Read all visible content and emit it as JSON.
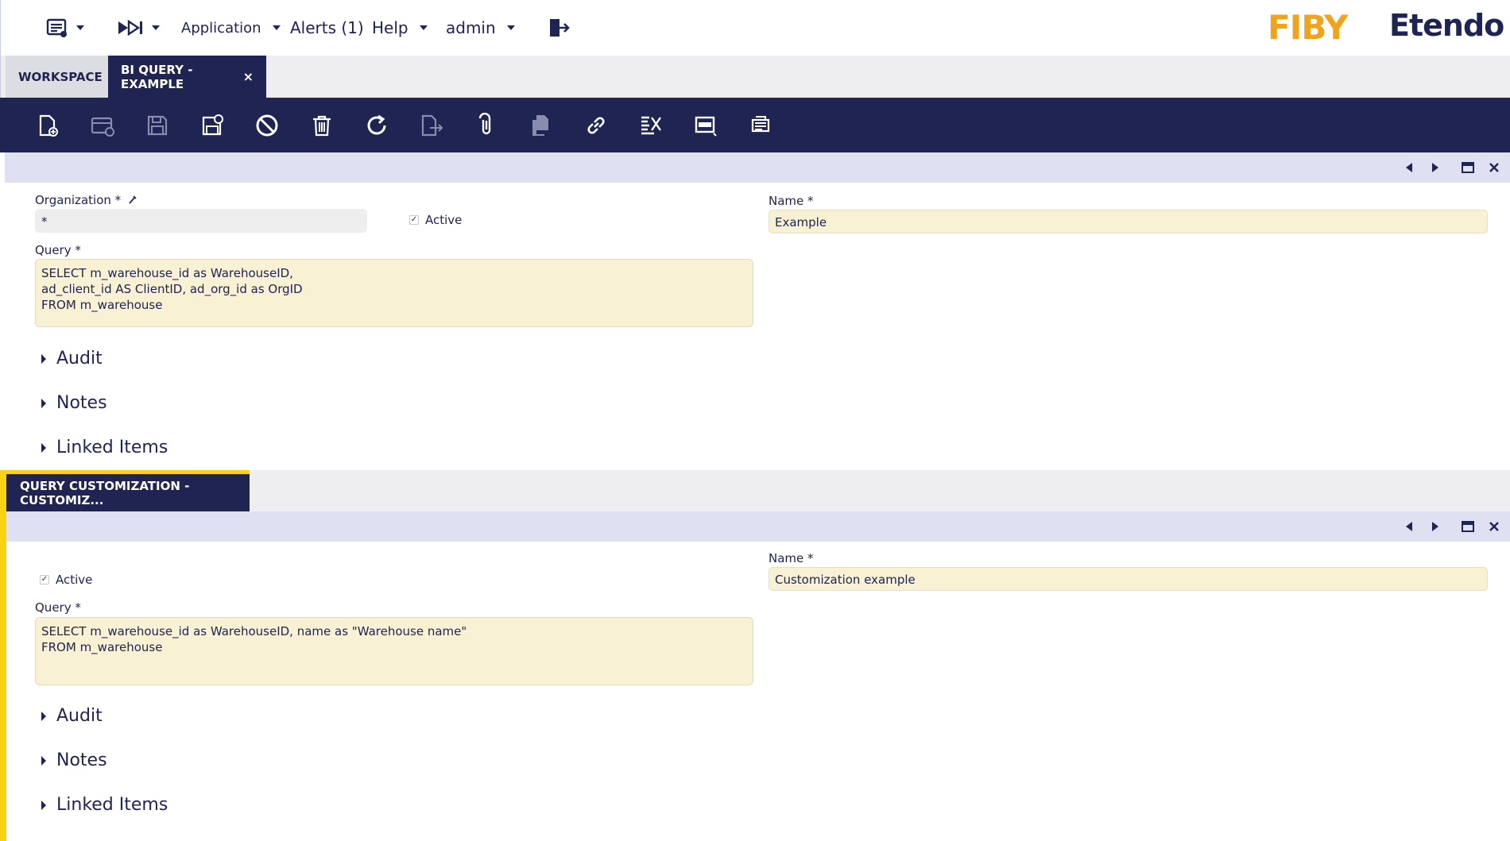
{
  "topnav": {
    "menu_icon": "window-menu-icon",
    "quick_launch_icon": "quick-launch-icon",
    "application_label": "Application",
    "alerts_label": "Alerts (1)",
    "help_label": "Help",
    "user_label": "admin",
    "logout_icon": "logout-icon",
    "logo_fiby": "FIBY",
    "logo_etendo": "Etendo"
  },
  "tabs": [
    {
      "label": "WORKSPACE"
    },
    {
      "label": "BI QUERY - EXAMPLE",
      "close": "×"
    }
  ],
  "toolbar": {
    "buttons": [
      {
        "name": "new-document-icon"
      },
      {
        "name": "new-row-icon"
      },
      {
        "name": "save-icon"
      },
      {
        "name": "save-close-icon"
      },
      {
        "name": "undo-icon"
      },
      {
        "name": "delete-icon"
      },
      {
        "name": "refresh-icon"
      },
      {
        "name": "export-icon"
      },
      {
        "name": "attachment-icon"
      },
      {
        "name": "clone-icon"
      },
      {
        "name": "link-icon"
      },
      {
        "name": "audit-trail-icon"
      },
      {
        "name": "form-view-icon"
      },
      {
        "name": "print-icon"
      }
    ]
  },
  "header_form": {
    "organization_label": "Organization *",
    "organization_value": "*",
    "active_label": "Active",
    "active_checked": true,
    "name_label": "Name *",
    "name_value": "Example",
    "query_label": "Query *",
    "query_value": "SELECT m_warehouse_id as WarehouseID,\nad_client_id AS ClientID, ad_org_id as OrgID\nFROM m_warehouse",
    "groups": [
      "Audit",
      "Notes",
      "Linked Items"
    ]
  },
  "subtab": {
    "label": "QUERY CUSTOMIZATION - CUSTOMIZ..."
  },
  "child_form": {
    "active_label": "Active",
    "active_checked": true,
    "name_label": "Name *",
    "name_value": "Customization example",
    "query_label": "Query *",
    "query_value": "SELECT m_warehouse_id as WarehouseID, name as \"Warehouse name\"\nFROM m_warehouse",
    "groups": [
      "Audit",
      "Notes",
      "Linked Items"
    ]
  },
  "colors": {
    "navy": "#202452",
    "accent_yellow": "#fad214",
    "field_bg": "#f8f1d3",
    "section_bar": "#dfe1f3"
  }
}
